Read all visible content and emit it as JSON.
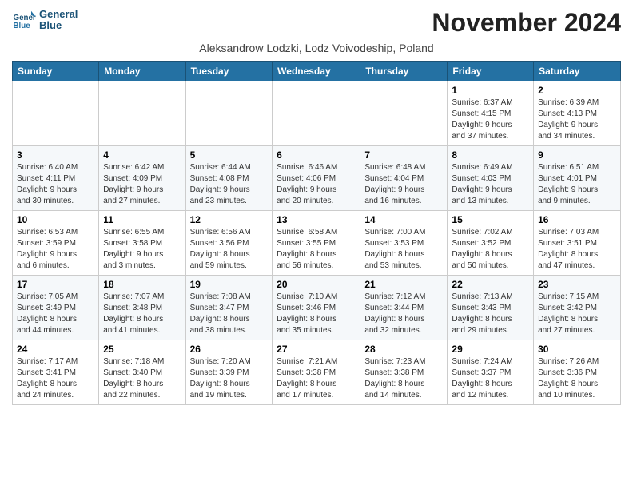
{
  "header": {
    "logo_line1": "General",
    "logo_line2": "Blue",
    "month_title": "November 2024",
    "subtitle": "Aleksandrow Lodzki, Lodz Voivodeship, Poland"
  },
  "weekdays": [
    "Sunday",
    "Monday",
    "Tuesday",
    "Wednesday",
    "Thursday",
    "Friday",
    "Saturday"
  ],
  "weeks": [
    [
      {
        "day": "",
        "info": ""
      },
      {
        "day": "",
        "info": ""
      },
      {
        "day": "",
        "info": ""
      },
      {
        "day": "",
        "info": ""
      },
      {
        "day": "",
        "info": ""
      },
      {
        "day": "1",
        "info": "Sunrise: 6:37 AM\nSunset: 4:15 PM\nDaylight: 9 hours\nand 37 minutes."
      },
      {
        "day": "2",
        "info": "Sunrise: 6:39 AM\nSunset: 4:13 PM\nDaylight: 9 hours\nand 34 minutes."
      }
    ],
    [
      {
        "day": "3",
        "info": "Sunrise: 6:40 AM\nSunset: 4:11 PM\nDaylight: 9 hours\nand 30 minutes."
      },
      {
        "day": "4",
        "info": "Sunrise: 6:42 AM\nSunset: 4:09 PM\nDaylight: 9 hours\nand 27 minutes."
      },
      {
        "day": "5",
        "info": "Sunrise: 6:44 AM\nSunset: 4:08 PM\nDaylight: 9 hours\nand 23 minutes."
      },
      {
        "day": "6",
        "info": "Sunrise: 6:46 AM\nSunset: 4:06 PM\nDaylight: 9 hours\nand 20 minutes."
      },
      {
        "day": "7",
        "info": "Sunrise: 6:48 AM\nSunset: 4:04 PM\nDaylight: 9 hours\nand 16 minutes."
      },
      {
        "day": "8",
        "info": "Sunrise: 6:49 AM\nSunset: 4:03 PM\nDaylight: 9 hours\nand 13 minutes."
      },
      {
        "day": "9",
        "info": "Sunrise: 6:51 AM\nSunset: 4:01 PM\nDaylight: 9 hours\nand 9 minutes."
      }
    ],
    [
      {
        "day": "10",
        "info": "Sunrise: 6:53 AM\nSunset: 3:59 PM\nDaylight: 9 hours\nand 6 minutes."
      },
      {
        "day": "11",
        "info": "Sunrise: 6:55 AM\nSunset: 3:58 PM\nDaylight: 9 hours\nand 3 minutes."
      },
      {
        "day": "12",
        "info": "Sunrise: 6:56 AM\nSunset: 3:56 PM\nDaylight: 8 hours\nand 59 minutes."
      },
      {
        "day": "13",
        "info": "Sunrise: 6:58 AM\nSunset: 3:55 PM\nDaylight: 8 hours\nand 56 minutes."
      },
      {
        "day": "14",
        "info": "Sunrise: 7:00 AM\nSunset: 3:53 PM\nDaylight: 8 hours\nand 53 minutes."
      },
      {
        "day": "15",
        "info": "Sunrise: 7:02 AM\nSunset: 3:52 PM\nDaylight: 8 hours\nand 50 minutes."
      },
      {
        "day": "16",
        "info": "Sunrise: 7:03 AM\nSunset: 3:51 PM\nDaylight: 8 hours\nand 47 minutes."
      }
    ],
    [
      {
        "day": "17",
        "info": "Sunrise: 7:05 AM\nSunset: 3:49 PM\nDaylight: 8 hours\nand 44 minutes."
      },
      {
        "day": "18",
        "info": "Sunrise: 7:07 AM\nSunset: 3:48 PM\nDaylight: 8 hours\nand 41 minutes."
      },
      {
        "day": "19",
        "info": "Sunrise: 7:08 AM\nSunset: 3:47 PM\nDaylight: 8 hours\nand 38 minutes."
      },
      {
        "day": "20",
        "info": "Sunrise: 7:10 AM\nSunset: 3:46 PM\nDaylight: 8 hours\nand 35 minutes."
      },
      {
        "day": "21",
        "info": "Sunrise: 7:12 AM\nSunset: 3:44 PM\nDaylight: 8 hours\nand 32 minutes."
      },
      {
        "day": "22",
        "info": "Sunrise: 7:13 AM\nSunset: 3:43 PM\nDaylight: 8 hours\nand 29 minutes."
      },
      {
        "day": "23",
        "info": "Sunrise: 7:15 AM\nSunset: 3:42 PM\nDaylight: 8 hours\nand 27 minutes."
      }
    ],
    [
      {
        "day": "24",
        "info": "Sunrise: 7:17 AM\nSunset: 3:41 PM\nDaylight: 8 hours\nand 24 minutes."
      },
      {
        "day": "25",
        "info": "Sunrise: 7:18 AM\nSunset: 3:40 PM\nDaylight: 8 hours\nand 22 minutes."
      },
      {
        "day": "26",
        "info": "Sunrise: 7:20 AM\nSunset: 3:39 PM\nDaylight: 8 hours\nand 19 minutes."
      },
      {
        "day": "27",
        "info": "Sunrise: 7:21 AM\nSunset: 3:38 PM\nDaylight: 8 hours\nand 17 minutes."
      },
      {
        "day": "28",
        "info": "Sunrise: 7:23 AM\nSunset: 3:38 PM\nDaylight: 8 hours\nand 14 minutes."
      },
      {
        "day": "29",
        "info": "Sunrise: 7:24 AM\nSunset: 3:37 PM\nDaylight: 8 hours\nand 12 minutes."
      },
      {
        "day": "30",
        "info": "Sunrise: 7:26 AM\nSunset: 3:36 PM\nDaylight: 8 hours\nand 10 minutes."
      }
    ]
  ]
}
